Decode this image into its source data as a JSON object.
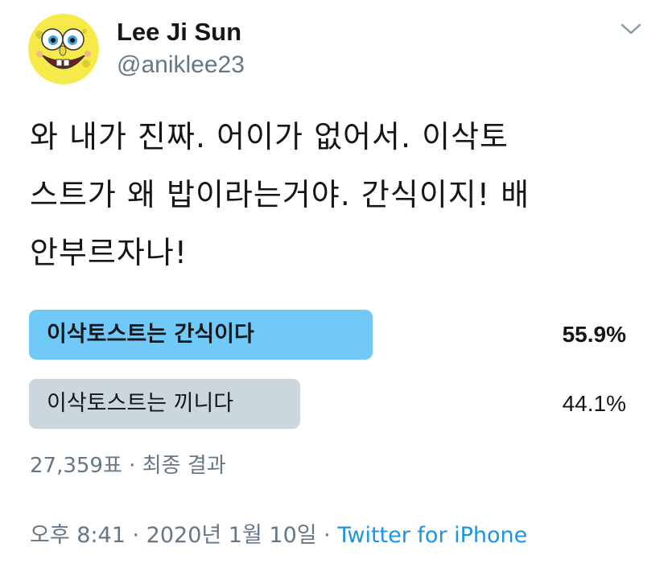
{
  "author": {
    "name": "Lee Ji Sun",
    "handle": "@aniklee23",
    "avatar_icon": "spongebob-avatar-icon"
  },
  "header": {
    "more_icon": "chevron-down-icon"
  },
  "tweet": {
    "text": "와 내가 진짜. 어이가 없어서. 이삭토\n스트가 왜 밥이라는거야. 간식이지! 배\n안부르자나!"
  },
  "poll": {
    "options": [
      {
        "label": "이삭토스트는 간식이다",
        "percent_text": "55.9%",
        "percent": 55.9,
        "winner": true
      },
      {
        "label": "이삭토스트는 끼니다",
        "percent_text": "44.1%",
        "percent": 44.1,
        "winner": false
      }
    ],
    "votes": "27,359표",
    "separator": " · ",
    "status": "최종 결과"
  },
  "footer": {
    "time": "오후 8:41",
    "separator": " · ",
    "date": "2020년 1월 10일",
    "separator2": " · ",
    "source": "Twitter for iPhone"
  },
  "colors": {
    "winner_bar": "#71c9f8",
    "loser_bar": "#ccd6dd",
    "link": "#1b95e0",
    "muted": "#657786"
  }
}
